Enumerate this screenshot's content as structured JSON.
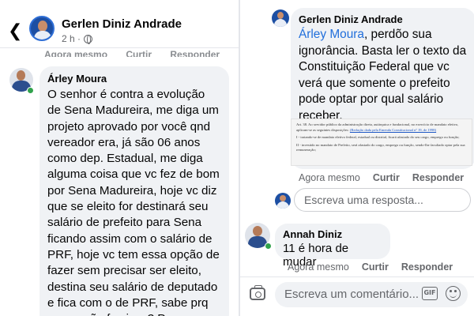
{
  "left": {
    "header": {
      "page_name": "Gerlen Diniz Andrade",
      "post_time": "2 h ·"
    },
    "previous_actions": {
      "time": "Agora mesmo",
      "like": "Curtir",
      "reply": "Responder"
    },
    "comment": {
      "author": "Árley Moura",
      "text": "O senhor é contra a evolução de Sena Madureira, me diga um projeto aprovado por você qnd vereador era, já são 06 anos como dep. Estadual, me diga alguma coisa que vc fez de bom por Sena Madureira, hoje vc diz que se eleito for destinará seu salário de prefeito para Sena ficando assim com o salário de PRF, hoje vc tem essa opção de fazer sem precisar ser eleito, destina seu salário de deputado e fica com o de PRF, sabe prq prq vc não faz isso? Prq vossa"
    }
  },
  "right": {
    "reply": {
      "author": "Gerlen Diniz Andrade",
      "mention": "Árley Moura",
      "text": ", perdõo sua ignorância. Basta ler o texto da Constituição Federal que vc verá que somente o prefeito pode optar por qual salário receber."
    },
    "law_excerpt": {
      "line1": "Art. 38. Ao servidor público da administração direta, autárquica e fundacional, no exercício de mandato eletivo, aplicam-se as seguintes disposições:",
      "link1": "(Redação dada pela Emenda Constitucional nº 19, de 1998)",
      "line2": "I - tratando-se de mandato eletivo federal, estadual ou distrital, ficará afastado do seu cargo, emprego ou função;",
      "line3": "II - investido no mandato de Prefeito, será afastado do cargo, emprego ou função, sendo-lhe facultado optar pela sua remuneração;"
    },
    "reply_actions": {
      "time": "Agora mesmo",
      "like": "Curtir",
      "reply": "Responder"
    },
    "reply_input": {
      "placeholder": "Escreva uma resposta..."
    },
    "annah": {
      "author": "Annah Diniz",
      "text": "11 é hora de mudar"
    },
    "annah_actions": {
      "time": "Agora mesmo",
      "like": "Curtir",
      "reply": "Responder"
    },
    "composer": {
      "placeholder": "Escreva um comentário...",
      "gif_label": "GIF"
    }
  },
  "icons": {
    "back": "back-arrow-icon",
    "privacy": "globe-icon",
    "camera": "camera-icon",
    "gif": "gif-icon",
    "emoji": "smile-icon"
  },
  "colors": {
    "mention": "#216fdb",
    "bubble": "#f0f2f5",
    "secondary_text": "#65676b",
    "online": "#31a24c"
  }
}
